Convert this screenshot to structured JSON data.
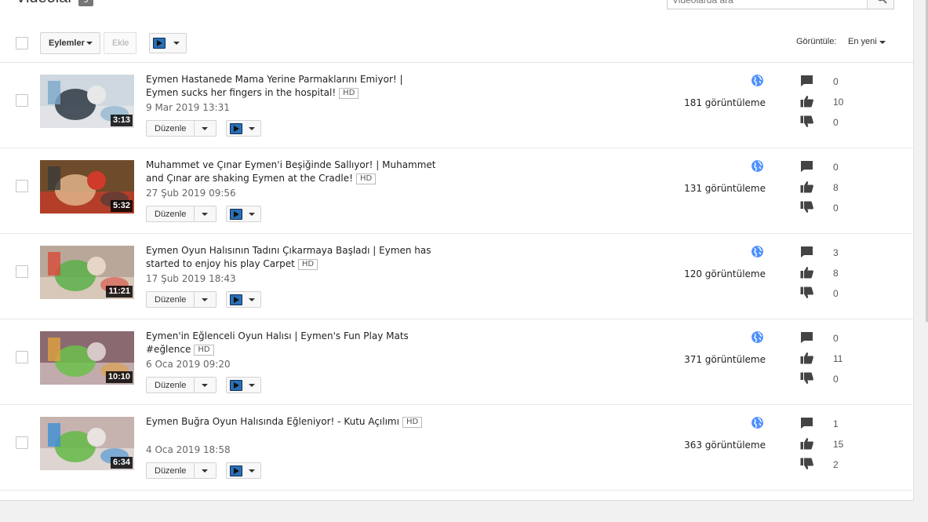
{
  "header": {
    "title": "Videolar",
    "count": "5",
    "search_placeholder": "Videolarda ara"
  },
  "toolbar": {
    "actions_label": "Eylemler",
    "add_label": "Ekle",
    "view_label": "Görüntüle:",
    "sort_value": "En yeni"
  },
  "colors": {
    "globe": "#4d90fe",
    "stat_icon": "#444444",
    "ext_logo": "#2a6fb5"
  },
  "videos": [
    {
      "title": "Eymen Hastanede Mama Yerine Parmaklarını Emiyor! | Eymen sucks her fingers in the hospital!",
      "quality": "HD",
      "date": "9 Mar 2019 13:31",
      "duration": "3:13",
      "views": "181 görüntüleme",
      "comments": "0",
      "likes": "10",
      "dislikes": "0",
      "edit_label": "Düzenle"
    },
    {
      "title": "Muhammet ve Çınar Eymen'i Beşiğinde Sallıyor! | Muhammet and Çınar are shaking Eymen at the Cradle!",
      "quality": "HD",
      "date": "27 Şub 2019 09:56",
      "duration": "5:32",
      "views": "131 görüntüleme",
      "comments": "0",
      "likes": "8",
      "dislikes": "0",
      "edit_label": "Düzenle"
    },
    {
      "title": "Eymen Oyun Halısının Tadını Çıkarmaya Başladı | Eymen has started to enjoy his play Carpet",
      "quality": "HD",
      "date": "17 Şub 2019 18:43",
      "duration": "11:21",
      "views": "120 görüntüleme",
      "comments": "3",
      "likes": "8",
      "dislikes": "0",
      "edit_label": "Düzenle"
    },
    {
      "title": "Eymen'in Eğlenceli Oyun Halısı | Eymen's Fun Play Mats #eğlence",
      "quality": "HD",
      "date": "6 Oca 2019 09:20",
      "duration": "10:10",
      "views": "371 görüntüleme",
      "comments": "0",
      "likes": "11",
      "dislikes": "0",
      "edit_label": "Düzenle"
    },
    {
      "title": "Eymen Buğra Oyun Halısında Eğleniyor! - Kutu Açılımı",
      "quality": "HD",
      "date": "4 Oca 2019 18:58",
      "duration": "6:34",
      "views": "363 görüntüleme",
      "comments": "1",
      "likes": "15",
      "dislikes": "2",
      "edit_label": "Düzenle"
    }
  ]
}
